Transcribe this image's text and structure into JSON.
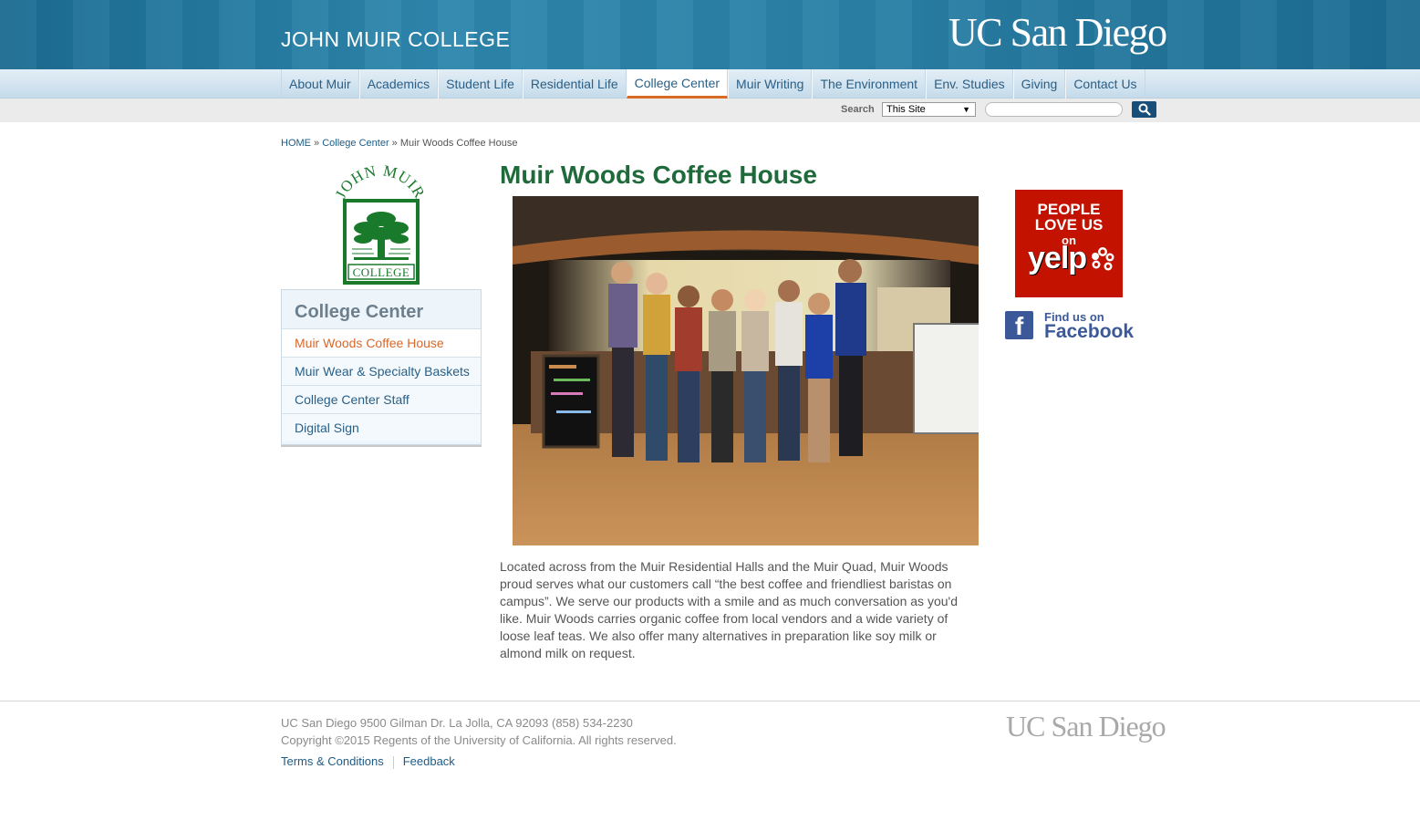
{
  "header": {
    "college_title": "JOHN MUIR COLLEGE",
    "ucsd_logo_text": "UC San Diego"
  },
  "nav": {
    "items": [
      {
        "label": "About Muir"
      },
      {
        "label": "Academics"
      },
      {
        "label": "Student Life"
      },
      {
        "label": "Residential Life"
      },
      {
        "label": "College Center",
        "active": true
      },
      {
        "label": "Muir Writing"
      },
      {
        "label": "The Environment"
      },
      {
        "label": "Env. Studies"
      },
      {
        "label": "Giving"
      },
      {
        "label": "Contact Us"
      }
    ]
  },
  "search": {
    "label": "Search",
    "scope_selected": "This Site",
    "query": "",
    "button_icon": "magnifier-icon"
  },
  "breadcrumb": {
    "home": "HOME",
    "sep1": " » ",
    "section": "College Center",
    "sep2": " » ",
    "current": "Muir Woods Coffee House"
  },
  "logo": {
    "arc_text": "JOHN MUIR",
    "banner_text": "COLLEGE",
    "color": "#1a7a2c"
  },
  "sidenav": {
    "heading": "College Center",
    "items": [
      {
        "label": "Muir Woods Coffee House",
        "active": true
      },
      {
        "label": "Muir Wear & Specialty Baskets"
      },
      {
        "label": "College Center Staff"
      },
      {
        "label": "Digital Sign"
      }
    ]
  },
  "main": {
    "title": "Muir Woods Coffee House",
    "body": "Located across from the Muir Residential Halls and the Muir Quad, Muir Woods proud serves what our customers call “the best coffee and friendliest baristas on campus”.  We serve our products with a smile and as much conversation as you'd like.  Muir Woods carries organic coffee from local vendors and a wide variety of loose leaf teas.  We also offer many alternatives in preparation like soy milk or almond milk on request."
  },
  "sidebar_right": {
    "yelp": {
      "line1": "PEOPLE",
      "line2": "LOVE US",
      "line3": "on",
      "brand": "yelp",
      "color": "#c41200"
    },
    "facebook": {
      "line1": "Find us on",
      "line2": "Facebook",
      "color": "#3b5998"
    }
  },
  "footer": {
    "address": "UC San Diego 9500 Gilman Dr. La Jolla, CA 92093 (858) 534-2230",
    "copyright": "Copyright ©2015 Regents of the University of California. All rights reserved.",
    "links": [
      {
        "label": "Terms & Conditions"
      },
      {
        "label": "Feedback"
      }
    ],
    "logo_text": "UC San Diego"
  },
  "colors": {
    "header_blue": "#2a80a7",
    "nav_active_underline": "#d86b24",
    "title_green": "#1e6a3a",
    "link_blue": "#1d5b86"
  }
}
